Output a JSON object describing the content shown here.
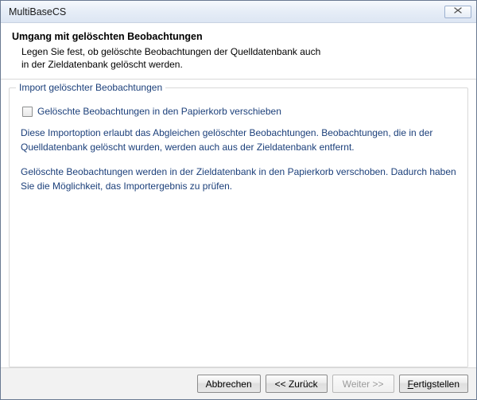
{
  "window": {
    "title": "MultiBaseCS"
  },
  "header": {
    "title": "Umgang mit gelöschten Beobachtungen",
    "desc_line1": "Legen Sie fest, ob gelöschte Beobachtungen der Quelldatenbank auch",
    "desc_line2": "in der Zieldatenbank gelöscht werden."
  },
  "group": {
    "legend": "Import gelöschter Beobachtungen",
    "checkbox_label": "Gelöschte Beobachtungen in den Papierkorb verschieben",
    "para1": "Diese Importoption erlaubt das Abgleichen gelöschter Beobachtungen. Beobachtungen, die in der Quelldatenbank gelöscht wurden, werden auch aus der Zieldatenbank entfernt.",
    "para2": "Gelöschte Beobachtungen werden in der Zieldatenbank in den Papierkorb verschoben. Dadurch haben Sie die Möglichkeit, das Importergebnis zu prüfen."
  },
  "buttons": {
    "cancel": "Abbrechen",
    "back": "<< Zurück",
    "next": "Weiter >>",
    "finish_pre": "F",
    "finish_post": "ertigstellen"
  }
}
